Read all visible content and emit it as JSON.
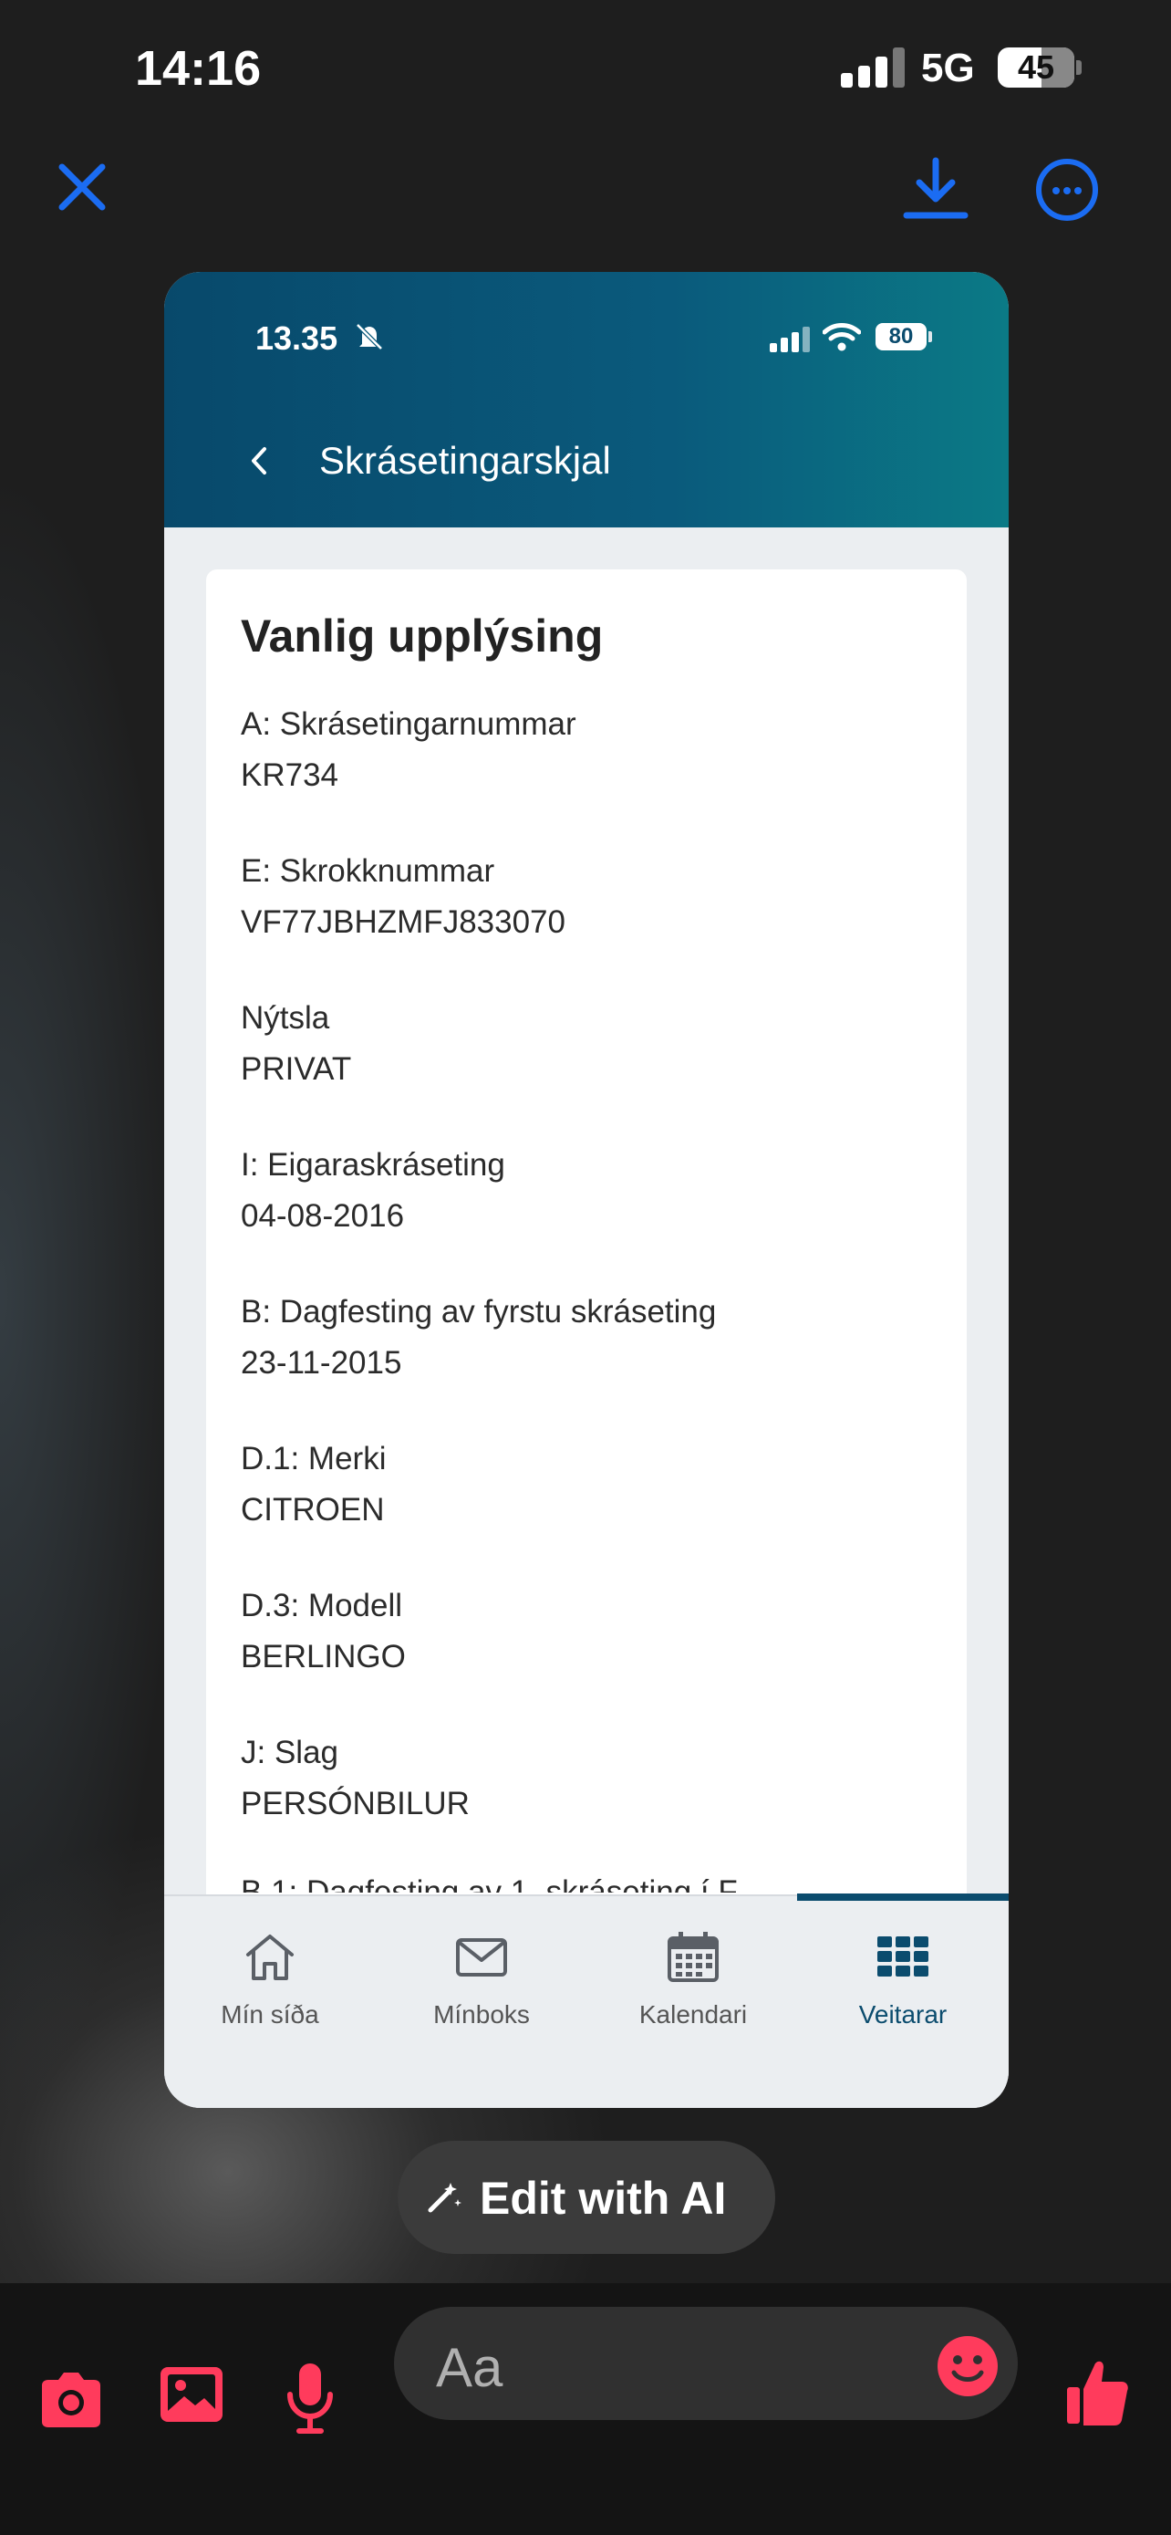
{
  "status_bar": {
    "time": "14:16",
    "network": "5G",
    "battery": "45"
  },
  "top_bar": {
    "close_icon": "close-icon",
    "download_icon": "download-icon",
    "more_icon": "more-icon",
    "accent_color": "#1b6cf2"
  },
  "preview": {
    "inner_status": {
      "time": "13.35",
      "battery": "80"
    },
    "header": {
      "title": "Skrásetingarskjal",
      "color": "#0b4c6e"
    },
    "section_title": "Vanlig upplýsing",
    "fields": [
      {
        "label": "A: Skrásetingarnummar",
        "value": "KR734"
      },
      {
        "label": "E: Skrokknummar",
        "value": "VF77JBHZMFJ833070"
      },
      {
        "label": "Nýtsla",
        "value": "PRIVAT"
      },
      {
        "label": "I: Eigaraskráseting",
        "value": "04-08-2016"
      },
      {
        "label": "B: Dagfesting av fyrstu skráseting",
        "value": "23-11-2015"
      },
      {
        "label": "D.1: Merki",
        "value": "CITROEN"
      },
      {
        "label": "D.3: Modell",
        "value": "BERLINGO"
      },
      {
        "label": "J: Slag",
        "value": "PERSÓNBILUR"
      }
    ],
    "cut_off_label": "B.1: Dagfesting av 1. skráseting í F",
    "nav": [
      {
        "label": "Mín síða",
        "icon": "home-icon"
      },
      {
        "label": "Mínboks",
        "icon": "mail-icon"
      },
      {
        "label": "Kalendari",
        "icon": "calendar-icon"
      },
      {
        "label": "Veitarar",
        "icon": "grid-icon",
        "active": true
      }
    ]
  },
  "edit_ai": {
    "label": "Edit with AI"
  },
  "composer": {
    "placeholder": "Aa",
    "accent_color": "#ff3b5c"
  }
}
